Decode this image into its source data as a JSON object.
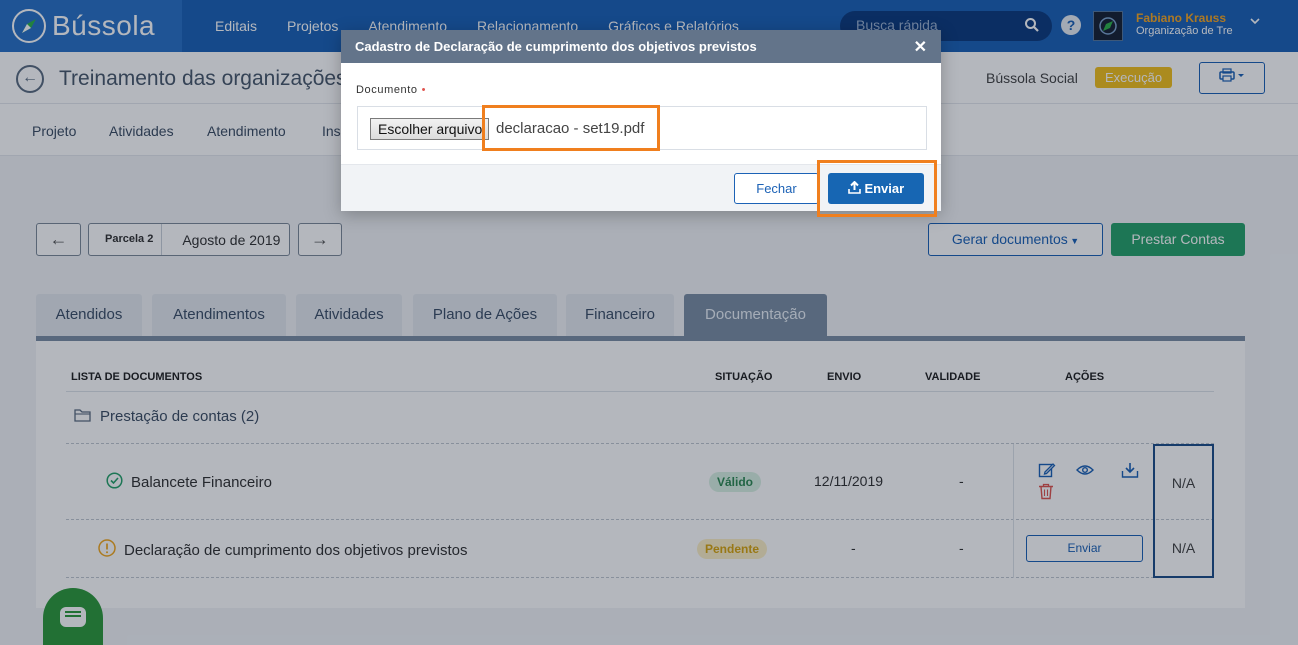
{
  "app": {
    "brand": "Bússola"
  },
  "nav": {
    "items": [
      "Editais",
      "Projetos",
      "Atendimento",
      "Relacionamento",
      "Gráficos e Relatórios"
    ],
    "search_placeholder": "Busca rápida",
    "help_label": "?",
    "user_name": "Fabiano Krauss",
    "user_org": "Organização de Tre"
  },
  "page": {
    "title": "Treinamento das organizações",
    "program": "Bússola Social",
    "status_badge": "Execução"
  },
  "subnav": {
    "items": [
      "Projeto",
      "Atividades",
      "Atendimento",
      "Ins"
    ]
  },
  "period": {
    "parcel_label": "Parcela 2",
    "parcel_value": "Agosto de 2019",
    "prev_symbol": "←",
    "next_symbol": "→"
  },
  "actions": {
    "generate_docs": "Gerar documentos",
    "render_accounts": "Prestar Contas"
  },
  "tabs": {
    "items": [
      "Atendidos",
      "Atendimentos",
      "Atividades",
      "Plano de Ações",
      "Financeiro",
      "Documentação"
    ],
    "active": "Documentação"
  },
  "documents": {
    "headers": {
      "list": "LISTA DE DOCUMENTOS",
      "status": "SITUAÇÃO",
      "sent": "ENVIO",
      "validity": "VALIDADE",
      "actions": "AÇÕES"
    },
    "group": "Prestação de contas (2)",
    "rows": [
      {
        "name": "Balancete Financeiro",
        "status": "Válido",
        "sent": "12/11/2019",
        "validity": "-",
        "extra": "N/A"
      },
      {
        "name": "Declaração de cumprimento dos objetivos previstos",
        "status": "Pendente",
        "sent": "-",
        "validity": "-",
        "extra": "N/A",
        "action_button": "Enviar"
      }
    ]
  },
  "modal": {
    "title": "Cadastro de Declaração de cumprimento dos objetivos previstos",
    "close_symbol": "✕",
    "field_label": "Documento",
    "required_mark": "•",
    "choose_button": "Escolher arquivo",
    "file_name": "declaracao - set19.pdf",
    "close_button": "Fechar",
    "send_button": "Enviar"
  },
  "colors": {
    "primary": "#1c62b6",
    "success": "#28a36a",
    "warning": "#f2c01e",
    "highlight": "#f07f1e"
  },
  "icons": [
    "compass-logo-icon",
    "search-icon",
    "help-icon",
    "chevron-down-icon",
    "back-arrow-icon",
    "printer-icon",
    "folder-icon",
    "check-circle-icon",
    "warning-circle-icon",
    "edit-icon",
    "eye-icon",
    "download-icon",
    "trash-icon",
    "upload-icon",
    "chat-icon",
    "close-icon"
  ]
}
